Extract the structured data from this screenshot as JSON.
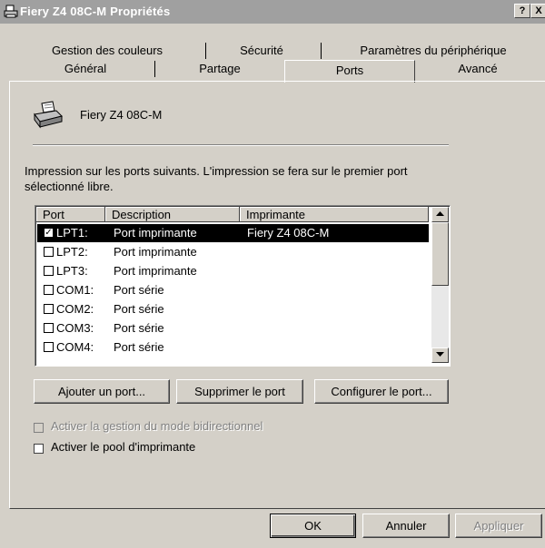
{
  "window": {
    "title": "Fiery Z4 08C-M Propriétés"
  },
  "title_buttons": {
    "help": "?",
    "close": "X"
  },
  "tabs": {
    "row2": [
      "Gestion des couleurs",
      "Sécurité",
      "Paramètres du périphérique"
    ],
    "row1": [
      "Général",
      "Partage",
      "Ports",
      "Avancé"
    ],
    "active": "Ports"
  },
  "printer_name": "Fiery Z4 08C-M",
  "description": "Impression sur les ports suivants. L'impression se fera sur le premier port sélectionné libre.",
  "ports_table": {
    "columns": [
      "Port",
      "Description",
      "Imprimante"
    ],
    "rows": [
      {
        "checked": true,
        "port": "LPT1:",
        "description": "Port imprimante",
        "printer": "Fiery Z4 08C-M",
        "selected": true
      },
      {
        "checked": false,
        "port": "LPT2:",
        "description": "Port imprimante",
        "printer": ""
      },
      {
        "checked": false,
        "port": "LPT3:",
        "description": "Port imprimante",
        "printer": ""
      },
      {
        "checked": false,
        "port": "COM1:",
        "description": "Port série",
        "printer": ""
      },
      {
        "checked": false,
        "port": "COM2:",
        "description": "Port série",
        "printer": ""
      },
      {
        "checked": false,
        "port": "COM3:",
        "description": "Port série",
        "printer": ""
      },
      {
        "checked": false,
        "port": "COM4:",
        "description": "Port série",
        "printer": ""
      }
    ]
  },
  "port_buttons": {
    "add": "Ajouter un port...",
    "delete": "Supprimer le port",
    "configure": "Configurer le port..."
  },
  "options": {
    "bidirectional": {
      "label": "Activer la gestion du mode bidirectionnel",
      "checked": false,
      "enabled": false
    },
    "pool": {
      "label": "Activer le pool d'imprimante",
      "checked": false,
      "enabled": true
    }
  },
  "dialog_buttons": {
    "ok": "OK",
    "cancel": "Annuler",
    "apply": "Appliquer"
  },
  "colors": {
    "titlebar": "#a0a0a0",
    "face": "#d4d0c8",
    "selection": "#000000"
  }
}
